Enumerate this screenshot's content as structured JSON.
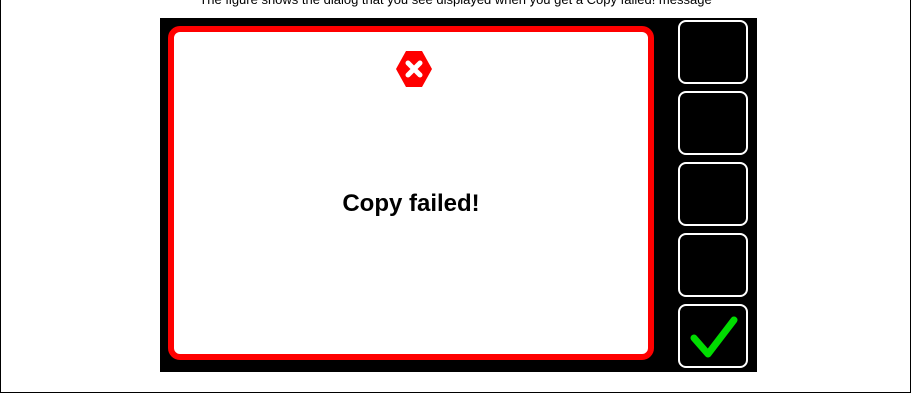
{
  "caption": {
    "text": "The figure shows the dialog that you see displayed when you get a Copy failed! message"
  },
  "dialog": {
    "message": "Copy failed!",
    "border_color": "#ff0000",
    "icon": "error-x-icon"
  },
  "softkeys": [
    {
      "icon": ""
    },
    {
      "icon": ""
    },
    {
      "icon": ""
    },
    {
      "icon": ""
    },
    {
      "icon": "checkmark-icon",
      "color": "#00dd00"
    }
  ]
}
